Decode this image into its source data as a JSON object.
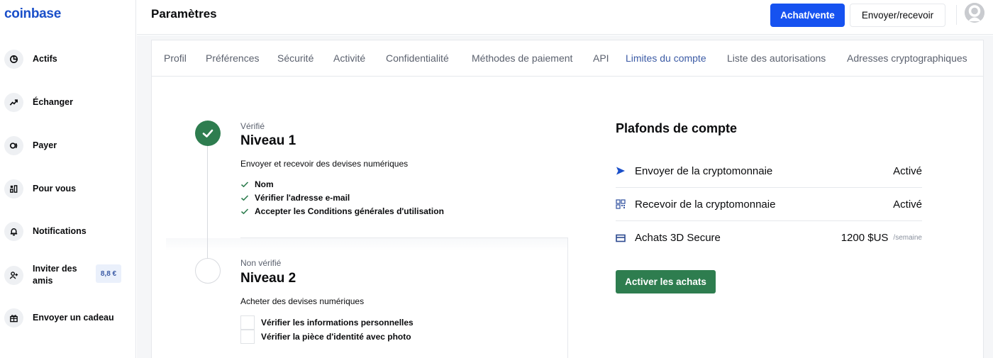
{
  "sidebar": {
    "logo": "coinbase",
    "items": [
      {
        "label": "Actifs",
        "icon": "pie-chart-icon"
      },
      {
        "label": "Échanger",
        "icon": "trend-up-icon"
      },
      {
        "label": "Payer",
        "icon": "pay-icon"
      },
      {
        "label": "Pour vous",
        "icon": "grid-icon"
      },
      {
        "label": "Notifications",
        "icon": "bell-icon"
      },
      {
        "label": "Inviter des amis",
        "icon": "add-user-icon",
        "badge": "8,8 €"
      },
      {
        "label": "Envoyer un cadeau",
        "icon": "gift-icon"
      }
    ]
  },
  "header": {
    "title": "Paramètres",
    "buy_sell_label": "Achat/vente",
    "send_receive_label": "Envoyer/recevoir"
  },
  "tabs": [
    {
      "label": "Profil"
    },
    {
      "label": "Préférences"
    },
    {
      "label": "Sécurité"
    },
    {
      "label": "Activité"
    },
    {
      "label": "Confidentialité"
    },
    {
      "label": "Méthodes de paiement"
    },
    {
      "label": "API"
    },
    {
      "label": "Limites du compte",
      "active": true
    },
    {
      "label": "Liste des autorisations"
    },
    {
      "label": "Adresses cryptographiques"
    }
  ],
  "levels": [
    {
      "status": "Vérifié",
      "title": "Niveau 1",
      "description": "Envoyer et recevoir des devises numériques",
      "requirements": [
        "Nom",
        "Vérifier l'adresse e-mail",
        "Accepter les Conditions générales d'utilisation"
      ],
      "completed": true
    },
    {
      "status": "Non vérifié",
      "title": "Niveau 2",
      "description": "Acheter des devises numériques",
      "requirements": [
        "Vérifier les informations personnelles",
        "Vérifier la pièce d'identité avec photo"
      ],
      "completed": false
    }
  ],
  "limits": {
    "title": "Plafonds de compte",
    "rows": [
      {
        "label": "Envoyer de la cryptomonnaie",
        "value": "Activé",
        "icon": "send-arrow-icon"
      },
      {
        "label": "Recevoir de la cryptomonnaie",
        "value": "Activé",
        "icon": "qr-code-icon"
      },
      {
        "label": "Achats 3D Secure",
        "value": "1200 $US",
        "unit": "/semaine",
        "icon": "credit-card-icon"
      }
    ],
    "activate_label": "Activer les achats"
  },
  "colors": {
    "brand_blue": "#1652f0",
    "success_green": "#2e7d4f",
    "logo_blue": "#1a4fc9"
  }
}
